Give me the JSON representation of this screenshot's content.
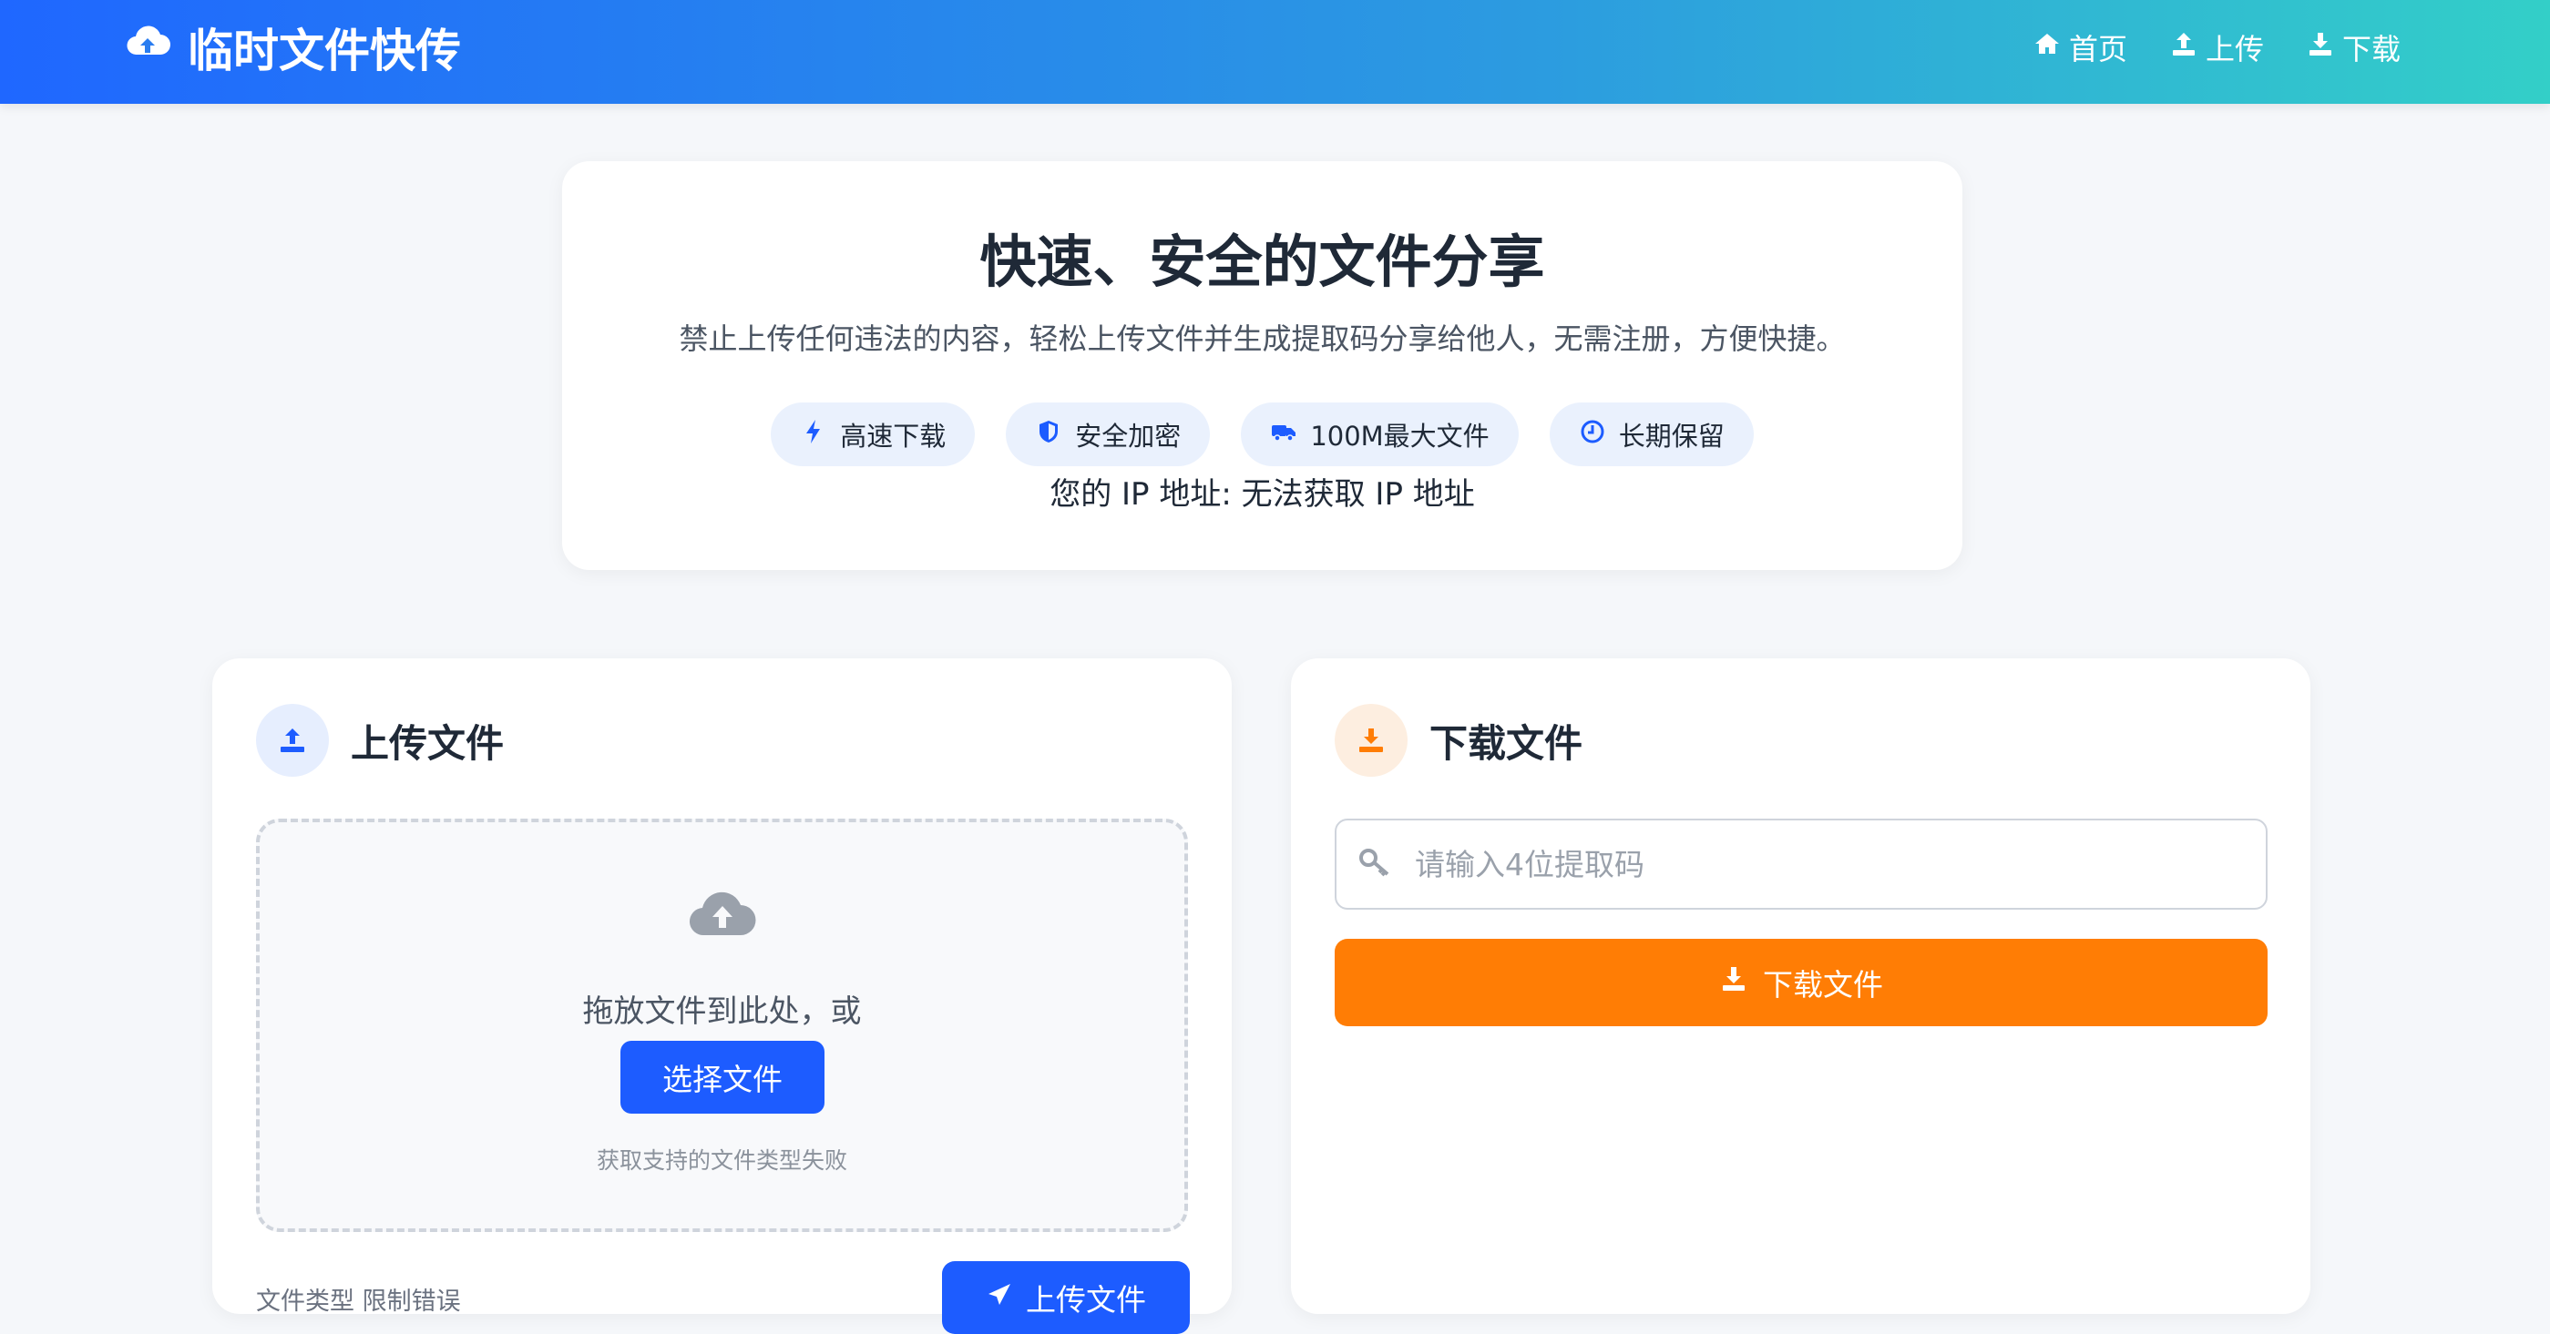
{
  "header": {
    "brand_title": "临时文件快传",
    "nav": [
      {
        "label": "首页",
        "icon": "home-icon"
      },
      {
        "label": "上传",
        "icon": "upload-icon"
      },
      {
        "label": "下载",
        "icon": "download-icon"
      }
    ]
  },
  "hero": {
    "title": "快速、安全的文件分享",
    "subtitle": "禁止上传任何违法的内容，轻松上传文件并生成提取码分享给他人，无需注册，方便快捷。",
    "features": [
      {
        "label": "高速下载",
        "icon": "bolt-icon"
      },
      {
        "label": "安全加密",
        "icon": "shield-icon"
      },
      {
        "label": "100M最大文件",
        "icon": "truck-icon"
      },
      {
        "label": "长期保留",
        "icon": "clock-icon"
      }
    ],
    "ip_text": "您的 IP 地址: 无法获取 IP 地址"
  },
  "upload_card": {
    "title": "上传文件",
    "drop_text": "拖放文件到此处，或",
    "choose_button": "选择文件",
    "hint": "获取支持的文件类型失败",
    "status_text": "文件类型 限制错误",
    "upload_button": "上传文件"
  },
  "download_card": {
    "title": "下载文件",
    "code_placeholder": "请输入4位提取码",
    "code_value": "",
    "download_button": "下载文件"
  },
  "colors": {
    "primary": "#1d5cff",
    "accent_orange": "#ff7d05",
    "header_gradient_start": "#1f67ff",
    "header_gradient_end": "#33cfc8"
  }
}
